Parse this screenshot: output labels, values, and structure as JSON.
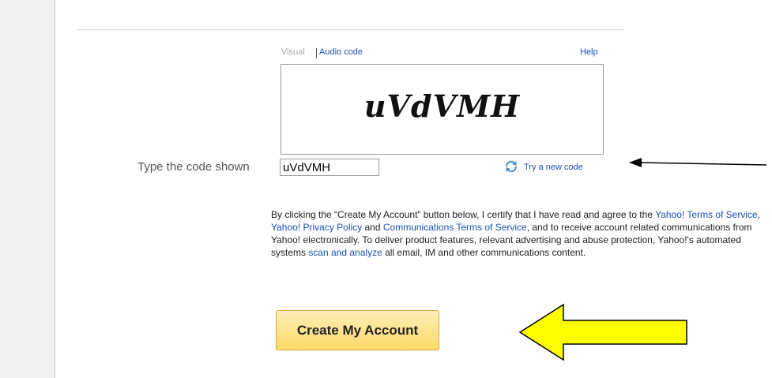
{
  "captcha": {
    "visual_tab": "Visual",
    "audio_tab": "Audio code",
    "help": "Help",
    "image_text": "uVdVMH"
  },
  "code_entry": {
    "label": "Type the code shown",
    "value": "uVdVMH",
    "try_new": "Try a new code"
  },
  "terms": {
    "t1": "By clicking the “Create My Account” button below, I certify that I have read and agree to the",
    "link_tos": "Yahoo! Terms of Service",
    "sep1": ", ",
    "link_privacy": "Yahoo! Privacy Policy",
    "and1": " and ",
    "link_comms": "Communications Terms of Service",
    "t2": ", and to receive account related communications from Yahoo! electronically. To deliver product features, relevant advertising and abuse protection, Yahoo!'s automated systems ",
    "link_scan": "scan and analyze",
    "t3": " all email, IM and other communications content."
  },
  "submit": {
    "label": "Create My Account"
  },
  "colors": {
    "link": "#1a50b4",
    "button_top": "#fff0b8",
    "button_bottom": "#ffd868",
    "arrow_fill": "#ffff00"
  },
  "icons": [
    "refresh-icon",
    "arrow-left-icon"
  ]
}
